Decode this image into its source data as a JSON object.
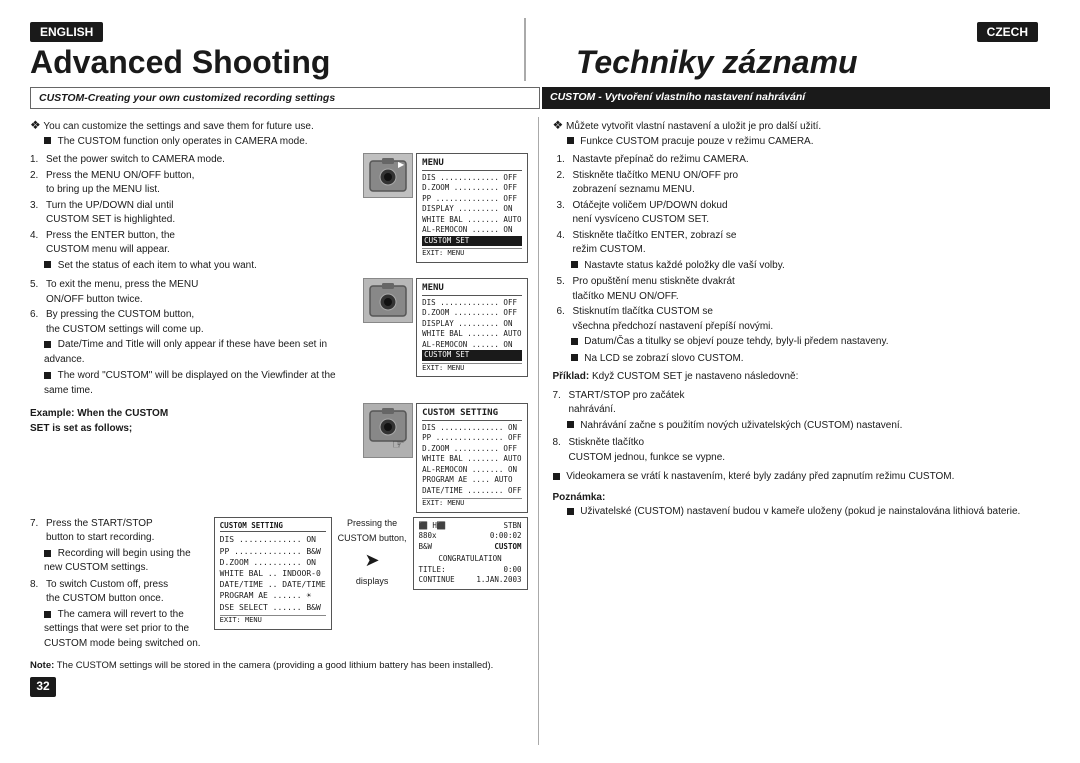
{
  "header": {
    "lang_english": "ENGLISH",
    "lang_czech": "CZECH",
    "title_english": "Advanced Shooting",
    "title_czech": "Techniky záznamu"
  },
  "section_bar": {
    "left": "CUSTOM-Creating your own customized recording settings",
    "right": "CUSTOM - Vytvoření vlastního nastavení nahrávání"
  },
  "english": {
    "intro1": "You can customize the settings and save them for future use.",
    "intro1_sub": "The CUSTOM function only operates in CAMERA mode.",
    "step1": "Set the power switch to CAMERA mode.",
    "step2_a": "Press the MENU ON/OFF button,",
    "step2_b": "to bring up the MENU list.",
    "step3_a": "Turn the UP/DOWN dial until",
    "step3_b": "CUSTOM SET is highlighted.",
    "step4_a": "Press the ENTER button, the",
    "step4_b": "CUSTOM menu will appear.",
    "step4_sub": "Set the status of each item to what you want.",
    "step5_a": "To exit the menu, press the MENU",
    "step5_b": "ON/OFF button twice.",
    "step6_a": "By pressing the CUSTOM button,",
    "step6_b": "the CUSTOM settings will come up.",
    "step6_sub1": "Date/Time and Title will only appear if these have been set in advance.",
    "step6_sub2": "The word \"CUSTOM\" will be displayed on the Viewfinder at the same time.",
    "example_title": "Example:  When the CUSTOM",
    "example_title2": "SET is set as follows;",
    "step7_a": "Press the START/STOP",
    "step7_b": "button to start recording.",
    "step7_sub": "Recording will begin using the new CUSTOM settings.",
    "step8_a": "To switch Custom off, press",
    "step8_b": "the CUSTOM button once.",
    "step8_sub": "The camera will revert to the settings that were set prior to the CUSTOM mode being switched on.",
    "note_label": "Note:",
    "note_text": "The CUSTOM settings will be stored in the camera (providing a good lithium battery has been installed).",
    "page_num": "32"
  },
  "czech": {
    "intro1": "Můžete vytvořit vlastní nastavení a uložit je pro další užití.",
    "intro1_sub": "Funkce CUSTOM pracuje pouze v režimu CAMERA.",
    "step1_a": "Nastavte přepínač do režimu",
    "step1_b": "CAMERA.",
    "step2_a": "Stiskněte tlačítko MENU ON/OFF pro",
    "step2_b": "zobrazení seznamu MENU.",
    "step3_a": "Otáčejte voličem UP/DOWN dokud",
    "step3_b": "není vysvíceno CUSTOM SET.",
    "step4_a": "Stiskněte tlačítko ENTER, zobrazí se",
    "step4_b": "režim CUSTOM.",
    "step4_sub": "Nastavte status každé položky dle vaší volby.",
    "step5_a": "Pro opuštění menu stiskněte dvakrát",
    "step5_b": "tlačítko MENU ON/OFF.",
    "step6_a": "Stisknutím tlačítka CUSTOM se",
    "step6_b": "všechna předchozí nastavení přepíší novými.",
    "step6_sub1": "Datum/Čas a titulky se objeví pouze tehdy, byly-li předem nastaveny.",
    "step6_sub2": "Na LCD se zobrazí slovo CUSTOM.",
    "priklad_label": "Příklad:",
    "priklad_text": "Když CUSTOM SET je nastaveno následovně:",
    "step7_a": "START/STOP pro začátek",
    "step7_b": "nahrávání.",
    "step7_sub": "Nahrávání začne s použitím nových uživatelských (CUSTOM) nastavení.",
    "step8_a": "Stiskněte tlačítko",
    "step8_b": "CUSTOM jednou, funkce se vypne.",
    "outro1": "Videokamera se vrátí k nastavením, které byly zadány před zapnutím režimu CUSTOM.",
    "poznamka_label": "Poznámka:",
    "poznamka_text": "Uživatelské (CUSTOM) nastavení budou v kameře uloženy (pokud je nainstalována lithiová baterie."
  },
  "menu_items_1": {
    "title": "MENU",
    "items": [
      "DIS .............. OFF",
      "D.ZOOM ........... OFF",
      "PP ............... OFF",
      "DISPLAY .......... ON",
      "WHITE BAL ........ AUTO",
      "AL-REMOCON ....... ON",
      "CUSTOM SET"
    ],
    "exit": "EXIT: MENU"
  },
  "menu_items_2": {
    "title": "MENU",
    "items": [
      "DIS .............. OFF",
      "D.ZOOM ........... OFF",
      "DISPLAY .......... ON",
      "WHITE BAL ........ AUTO",
      "AL-REMOCON ....... ON",
      "CUSTOM SET"
    ],
    "exit": "EXIT: MENU"
  },
  "menu_items_3": {
    "title": "CUSTOM SETTING",
    "items": [
      "DIS .............. ON",
      "PP ............... OFF",
      "D.ZOOM ........... OFF",
      "WHITE BAL ....... AUTO",
      "AL-REMOCON ....... ON",
      "PROGRAM AE ....... AUTO",
      "DATE/TIME ........ OFF"
    ],
    "exit": "EXIT: MENU"
  },
  "custom_setting_box": {
    "title": "CUSTOM SETTING",
    "items": [
      "DIS .............. ON",
      "PP ............... B&W",
      "D.ZOOM ........... ON",
      "WHITE BAL ... INDOOR-0",
      "DATE/TIME ... DATE/TIME",
      "PROGRAM AE ....... ☀",
      "DSE SELECT ....... B&W"
    ],
    "exit": "EXIT: MENU"
  },
  "viewfinder_box": {
    "line1": "        ⬛ H⬛ STBN",
    "line2": "⬛⬛⬛ 880x      0:00:02",
    "line3": "    B&W         CUSTOM",
    "label": "CONGRATULATION",
    "title_label": "TITLE:",
    "title_val": "0:00",
    "continue_label": "CONTINUE",
    "date_val": "1.JAN.2003"
  },
  "pressing_text": "Pressing the",
  "custom_button_text": "CUSTOM button,",
  "displays_text": "displays"
}
